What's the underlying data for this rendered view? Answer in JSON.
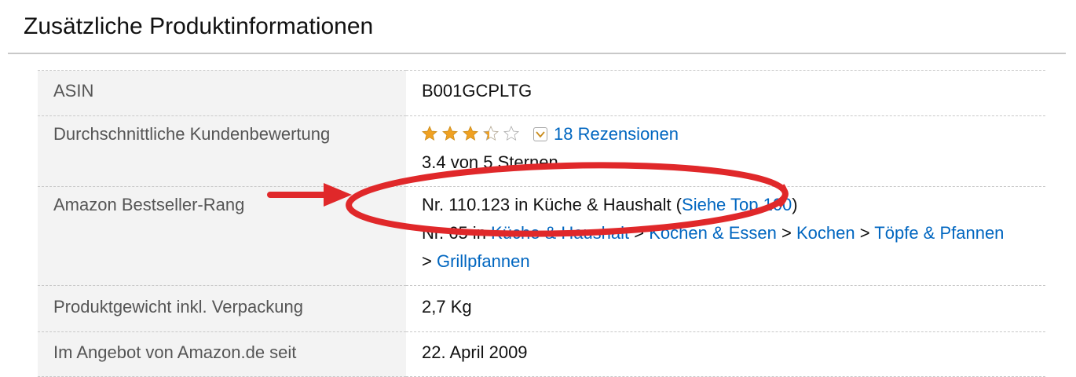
{
  "heading": "Zusätzliche Produktinformationen",
  "rows": [
    {
      "label": "ASIN",
      "value": "B001GCPLTG"
    },
    {
      "label": "Durchschnittliche Kundenbewertung",
      "rating": 3.4,
      "reviews_link": "18 Rezensionen",
      "rating_text": "3.4 von 5 Sternen"
    },
    {
      "label": "Amazon Bestseller-Rang",
      "rank_main": "Nr. 110.123 in Küche & Haushalt (",
      "top100_link": "Siehe Top 100",
      "rank_main_end": ")",
      "sub_rank_prefix": "Nr. 65 in ",
      "sub_categories": [
        "Küche & Haushalt",
        "Kochen & Essen",
        "Kochen",
        "Töpfe & Pfannen",
        "Grillpfannen"
      ],
      "separator": " > "
    },
    {
      "label": "Produktgewicht inkl. Verpackung",
      "value": "2,7 Kg"
    },
    {
      "label": "Im Angebot von Amazon.de seit",
      "value": "22. April 2009"
    }
  ],
  "colors": {
    "link": "#0066c0",
    "star": "#f0a122",
    "annotation": "#e0282a",
    "label_bg": "#f3f3f3"
  },
  "icons": {
    "rating": "star-rating-icon",
    "dropdown": "chevron-down-icon",
    "arrow": "red-arrow-annotation",
    "ellipse": "red-ellipse-annotation"
  }
}
